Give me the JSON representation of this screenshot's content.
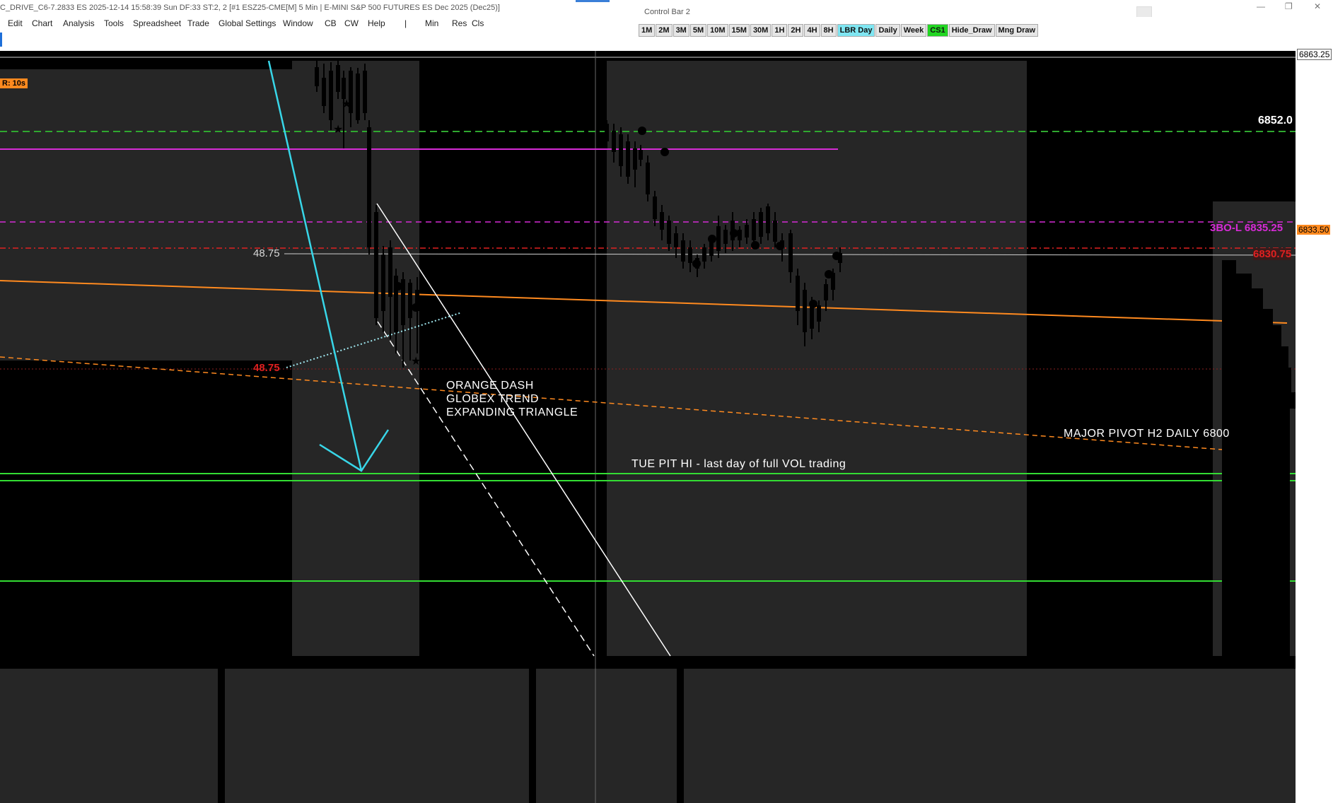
{
  "window": {
    "title": "C_DRIVE_C6-7.2833 ES 2025-12-14  15:58:39 Sun DF:33  ST:2, 2 [#1 ESZ25-CME[M]  5 Min  | E-MINI S&P 500 FUTURES ES Dec 2025 (Dec25)]",
    "control_bar_title": "Control Bar 2"
  },
  "menu": [
    "Edit",
    "Chart",
    "Analysis",
    "Tools",
    "Spreadsheet",
    "Trade",
    "Global Settings",
    "Window",
    "CB",
    "CW",
    "Help",
    "|",
    "Min",
    "Res",
    "Cls"
  ],
  "timeframes": [
    {
      "label": "1M",
      "state": "normal"
    },
    {
      "label": "2M",
      "state": "normal"
    },
    {
      "label": "3M",
      "state": "normal"
    },
    {
      "label": "5M",
      "state": "normal"
    },
    {
      "label": "10M",
      "state": "normal"
    },
    {
      "label": "15M",
      "state": "normal"
    },
    {
      "label": "30M",
      "state": "normal"
    },
    {
      "label": "1H",
      "state": "normal"
    },
    {
      "label": "2H",
      "state": "normal"
    },
    {
      "label": "4H",
      "state": "normal"
    },
    {
      "label": "8H",
      "state": "normal"
    },
    {
      "label": "LBR Day",
      "state": "selected"
    },
    {
      "label": "Daily",
      "state": "normal"
    },
    {
      "label": "Week",
      "state": "normal"
    },
    {
      "label": "CS1",
      "state": "active"
    },
    {
      "label": "Hide_Draw",
      "state": "normal"
    },
    {
      "label": "Mng Draw",
      "state": "normal"
    }
  ],
  "chart": {
    "timer_badge": "R: 10s",
    "price_axis": {
      "top": "6863.25",
      "current": "6833.50"
    },
    "level_labels": {
      "green_dash_right": "6852.0",
      "magenta_right": "3BO-L  6835.25",
      "red_right": "6830.75",
      "white_left": "48.75",
      "red_left": "48.75"
    },
    "annotations": {
      "orange_dash_1": "ORANGE DASH",
      "orange_dash_2": "GLOBEX TREND",
      "orange_dash_3": "EXPANDING TRIANGLE",
      "pit_hi": "TUE PIT HI - last day of full VOL trading",
      "pivot": "MAJOR PIVOT H2 DAILY 6800"
    },
    "colors": {
      "background": "#000000",
      "shade": "#262626",
      "green_line": "#33dd33",
      "magenta_line": "#d62bd6",
      "orange_line": "#ff8a1f",
      "red_line": "#e02020",
      "cyan_arrow": "#38d6e8",
      "axis_current": "#ff8a1f"
    }
  }
}
